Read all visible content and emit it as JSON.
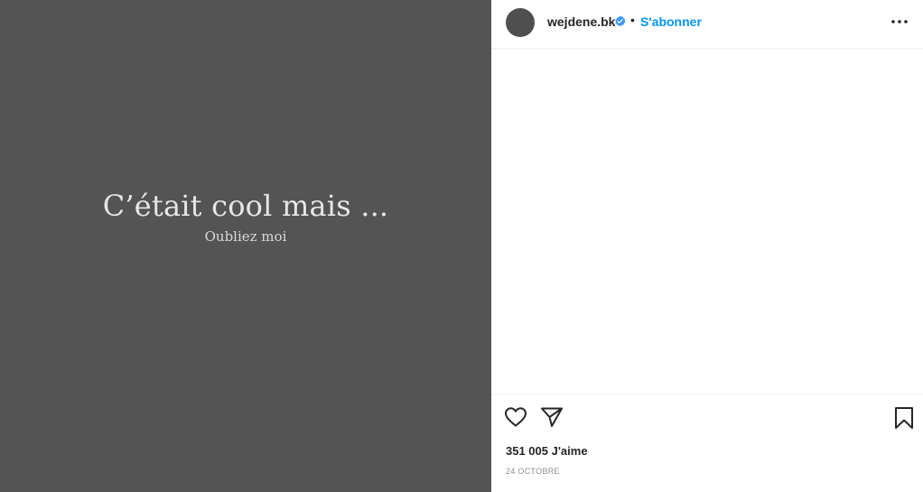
{
  "post": {
    "media": {
      "title": "C’était cool mais ...",
      "subtitle": "Oubliez moi"
    },
    "header": {
      "username": "wejdene.bk",
      "verified_icon": "verified-badge-icon",
      "separator": "•",
      "follow_label": "S'abonner",
      "more_icon": "more-horizontal-icon"
    },
    "actions": {
      "like_icon": "heart-icon",
      "share_icon": "paper-plane-icon",
      "save_icon": "bookmark-icon"
    },
    "likes_text": "351 005 J'aime",
    "date_text": "24 OCTOBRE"
  },
  "colors": {
    "media_bg": "#545454",
    "accent": "#0095f6",
    "text": "#262626",
    "muted": "#8e8e8e"
  }
}
